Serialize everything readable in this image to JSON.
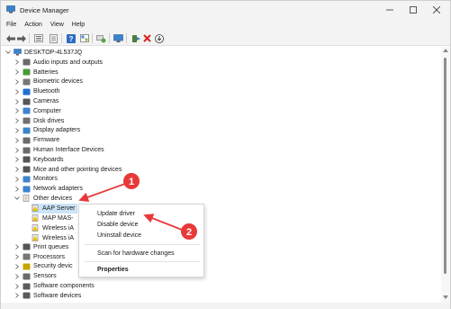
{
  "window": {
    "title": "Device Manager"
  },
  "menu": [
    "File",
    "Action",
    "View",
    "Help"
  ],
  "toolbar_icons": [
    "back-arrow-icon",
    "forward-arrow-icon",
    "device-view-icon",
    "properties-icon",
    "help-icon",
    "device-list-icon",
    "refresh-icon",
    "monitor-icon",
    "add-driver-icon",
    "uninstall-x-icon",
    "download-icon"
  ],
  "tree": {
    "root": "DESKTOP-4L537JQ",
    "categories": [
      "Audio inputs and outputs",
      "Batteries",
      "Biometric devices",
      "Bluetooth",
      "Cameras",
      "Computer",
      "Disk drives",
      "Display adapters",
      "Firmware",
      "Human Interface Devices",
      "Keyboards",
      "Mice and other pointing devices",
      "Monitors",
      "Network adapters",
      "Other devices"
    ],
    "other_devices": [
      "AAP Server",
      "MAP MAS-",
      "Wireless iA",
      "Wireless iA"
    ],
    "after": [
      "Print queues",
      "Processors",
      "Security devic",
      "Sensors",
      "Software components",
      "Software devices"
    ]
  },
  "context_menu": {
    "items": [
      "Update driver",
      "Disable device",
      "Uninstall device",
      "Scan for hardware changes",
      "Properties"
    ]
  },
  "annotations": {
    "badge1": "1",
    "badge2": "2"
  },
  "colors": {
    "accent_red": "#e8393a",
    "selection": "#cce4f7"
  }
}
